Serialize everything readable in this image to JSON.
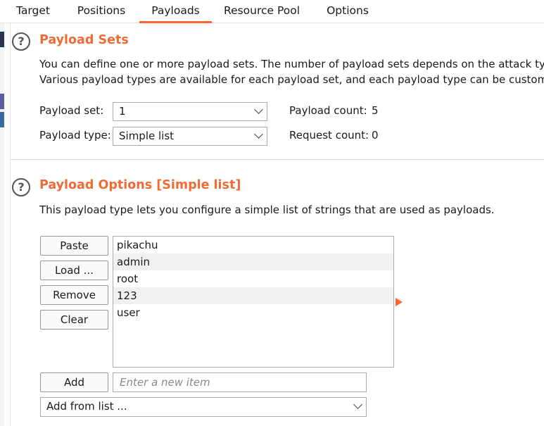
{
  "tabs": [
    {
      "label": "Target",
      "active": false
    },
    {
      "label": "Positions",
      "active": false
    },
    {
      "label": "Payloads",
      "active": true
    },
    {
      "label": "Resource Pool",
      "active": false
    },
    {
      "label": "Options",
      "active": false
    }
  ],
  "payload_sets": {
    "help_icon": "?",
    "title": "Payload Sets",
    "desc_line1": "You can define one or more payload sets. The number of payload sets depends on the attack type d",
    "desc_line2": "Various payload types are available for each payload set, and each payload type can be customized",
    "set_label": "Payload set:",
    "set_value": "1",
    "type_label": "Payload type:",
    "type_value": "Simple list",
    "count_label": "Payload count:",
    "count_value": "5",
    "request_label": "Request count:",
    "request_value": "0"
  },
  "payload_options": {
    "help_icon": "?",
    "title": "Payload Options [Simple list]",
    "desc": "This payload type lets you configure a simple list of strings that are used as payloads.",
    "buttons": {
      "paste": "Paste",
      "load": "Load ...",
      "remove": "Remove",
      "clear": "Clear",
      "add": "Add"
    },
    "items": [
      "pikachu",
      "admin",
      "root",
      "123",
      "user"
    ],
    "new_item_placeholder": "Enter a new item",
    "add_from_list": "Add from list ..."
  },
  "colors": {
    "accent": "#ff6633",
    "section_title": "#ef6b35"
  }
}
